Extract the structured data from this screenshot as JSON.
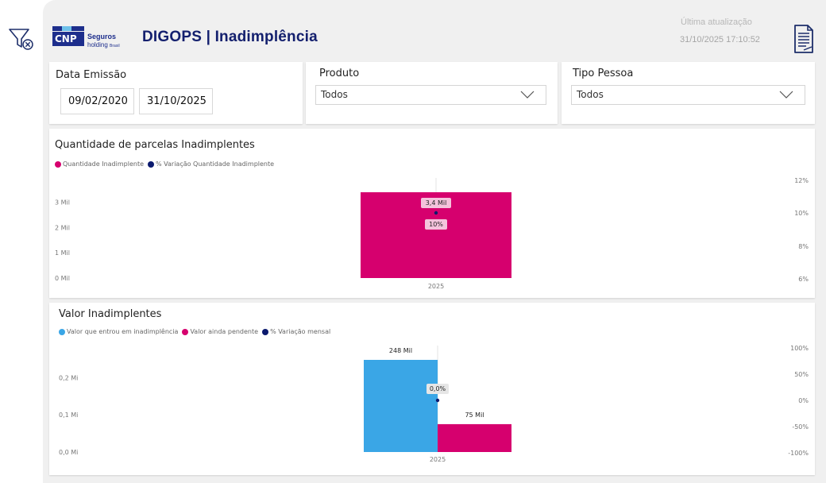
{
  "header": {
    "title": "DIGOPS | Inadimplência",
    "logo_brand": "CNP",
    "logo_line1": "Seguros",
    "logo_line2": "holding",
    "logo_line2_small": "Brasil",
    "last_update_label": "Última atualização",
    "last_update_value": "31/10/2025 17:10:52"
  },
  "icons": {
    "filter_clear": "filter-clear-icon",
    "report": "report-document-icon",
    "chevron": "chevron-down-icon"
  },
  "colors": {
    "title": "#14206e",
    "magenta": "#d6006e",
    "navy": "#0b1a6e",
    "light_blue": "#3aa6e6"
  },
  "filters": {
    "date": {
      "title": "Data Emissão",
      "start": "09/02/2020",
      "end": "31/10/2025"
    },
    "produto": {
      "title": "Produto",
      "selected": "Todos"
    },
    "tipo_pessoa": {
      "title": "Tipo Pessoa",
      "selected": "Todos"
    }
  },
  "chart_data": [
    {
      "type": "bar",
      "title": "Quantidade de parcelas Inadimplentes",
      "categories": [
        "2025"
      ],
      "series": [
        {
          "name": "Quantidade Inadimplente",
          "kind": "bar",
          "axis": "left",
          "color": "#d6006e",
          "values": [
            3400
          ],
          "labels": [
            "3,4 Mil"
          ]
        },
        {
          "name": "% Variação Quantidade Inadimplente",
          "kind": "line",
          "axis": "right",
          "color": "#0b1a6e",
          "values": [
            10
          ],
          "labels": [
            "10%"
          ]
        }
      ],
      "y_left": {
        "ticks": [
          0,
          1000,
          2000,
          3000
        ],
        "tick_labels": [
          "0 Mil",
          "1 Mil",
          "2 Mil",
          "3 Mil"
        ],
        "lim": [
          0,
          3400
        ]
      },
      "y_right": {
        "ticks": [
          6,
          8,
          10,
          12
        ],
        "tick_labels": [
          "6%",
          "8%",
          "10%",
          "12%"
        ],
        "lim": [
          6,
          12
        ]
      },
      "legend_position": "top-left"
    },
    {
      "type": "bar",
      "title": "Valor Inadimplentes",
      "categories": [
        "2025"
      ],
      "series": [
        {
          "name": "Valor que entrou em inadimplência",
          "kind": "bar",
          "axis": "left",
          "color": "#3aa6e6",
          "values": [
            248000
          ],
          "labels": [
            "248 Mil"
          ]
        },
        {
          "name": "Valor ainda pendente",
          "kind": "bar",
          "axis": "left",
          "color": "#d6006e",
          "values": [
            75000
          ],
          "labels": [
            "75 Mil"
          ]
        },
        {
          "name": "% Variação mensal",
          "kind": "line",
          "axis": "right",
          "color": "#0b1a6e",
          "values": [
            0
          ],
          "labels": [
            "0,0%"
          ]
        }
      ],
      "y_left": {
        "ticks": [
          0,
          100000,
          200000
        ],
        "tick_labels": [
          "0,0 Mi",
          "0,1 Mi",
          "0,2 Mi"
        ],
        "lim": [
          0,
          248000
        ]
      },
      "y_right": {
        "ticks": [
          -100,
          -50,
          0,
          50,
          100
        ],
        "tick_labels": [
          "-100%",
          "-50%",
          "0%",
          "50%",
          "100%"
        ],
        "lim": [
          -100,
          100
        ]
      },
      "legend_position": "top-left"
    }
  ]
}
